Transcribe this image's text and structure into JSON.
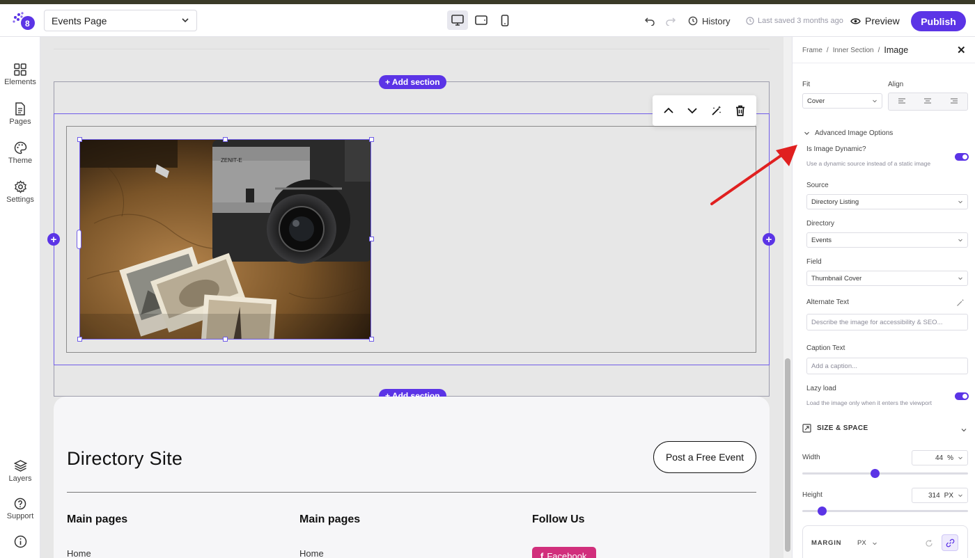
{
  "topbar": {
    "page_name": "Events Page",
    "history_label": "History",
    "saved_label": "Last saved 3 months ago",
    "preview_label": "Preview",
    "publish_label": "Publish"
  },
  "nav": {
    "elements": "Elements",
    "pages": "Pages",
    "theme": "Theme",
    "settings": "Settings",
    "layers": "Layers",
    "support": "Support"
  },
  "canvas": {
    "add_section_label": "+ Add section",
    "footer": {
      "title": "Directory Site",
      "cta": "Post a Free Event",
      "columns": [
        {
          "heading": "Main pages",
          "first_link": "Home"
        },
        {
          "heading": "Main pages",
          "first_link": "Home"
        },
        {
          "heading": "Follow Us",
          "first_link": "Facebook"
        }
      ]
    }
  },
  "panel": {
    "breadcrumb": [
      "Frame",
      "Inner Section",
      "Image"
    ],
    "fit_label": "Fit",
    "fit_value": "Cover",
    "align_label": "Align",
    "advanced_label": "Advanced Image Options",
    "dynamic_label": "Is Image Dynamic?",
    "dynamic_desc": "Use a dynamic source instead of a static image",
    "dynamic_on": true,
    "source_label": "Source",
    "source_value": "Directory Listing",
    "directory_label": "Directory",
    "directory_value": "Events",
    "field_label": "Field",
    "field_value": "Thumbnail Cover",
    "alt_label": "Alternate Text",
    "alt_placeholder": "Describe the image for accessibility & SEO...",
    "caption_label": "Caption Text",
    "caption_placeholder": "Add a caption...",
    "lazy_label": "Lazy load",
    "lazy_desc": "Load the image only when it enters the viewport",
    "lazy_on": true,
    "size_section": "SIZE & SPACE",
    "width_label": "Width",
    "width_value": "44",
    "width_unit": "%",
    "width_slider_fraction": 0.44,
    "height_label": "Height",
    "height_value": "314",
    "height_unit": "PX",
    "height_slider_fraction": 0.12,
    "margin_label": "MARGIN",
    "margin_unit": "PX"
  },
  "colors": {
    "accent": "#5b34e6",
    "annotation_arrow": "#e02020",
    "facebook": "#d12f7c"
  }
}
